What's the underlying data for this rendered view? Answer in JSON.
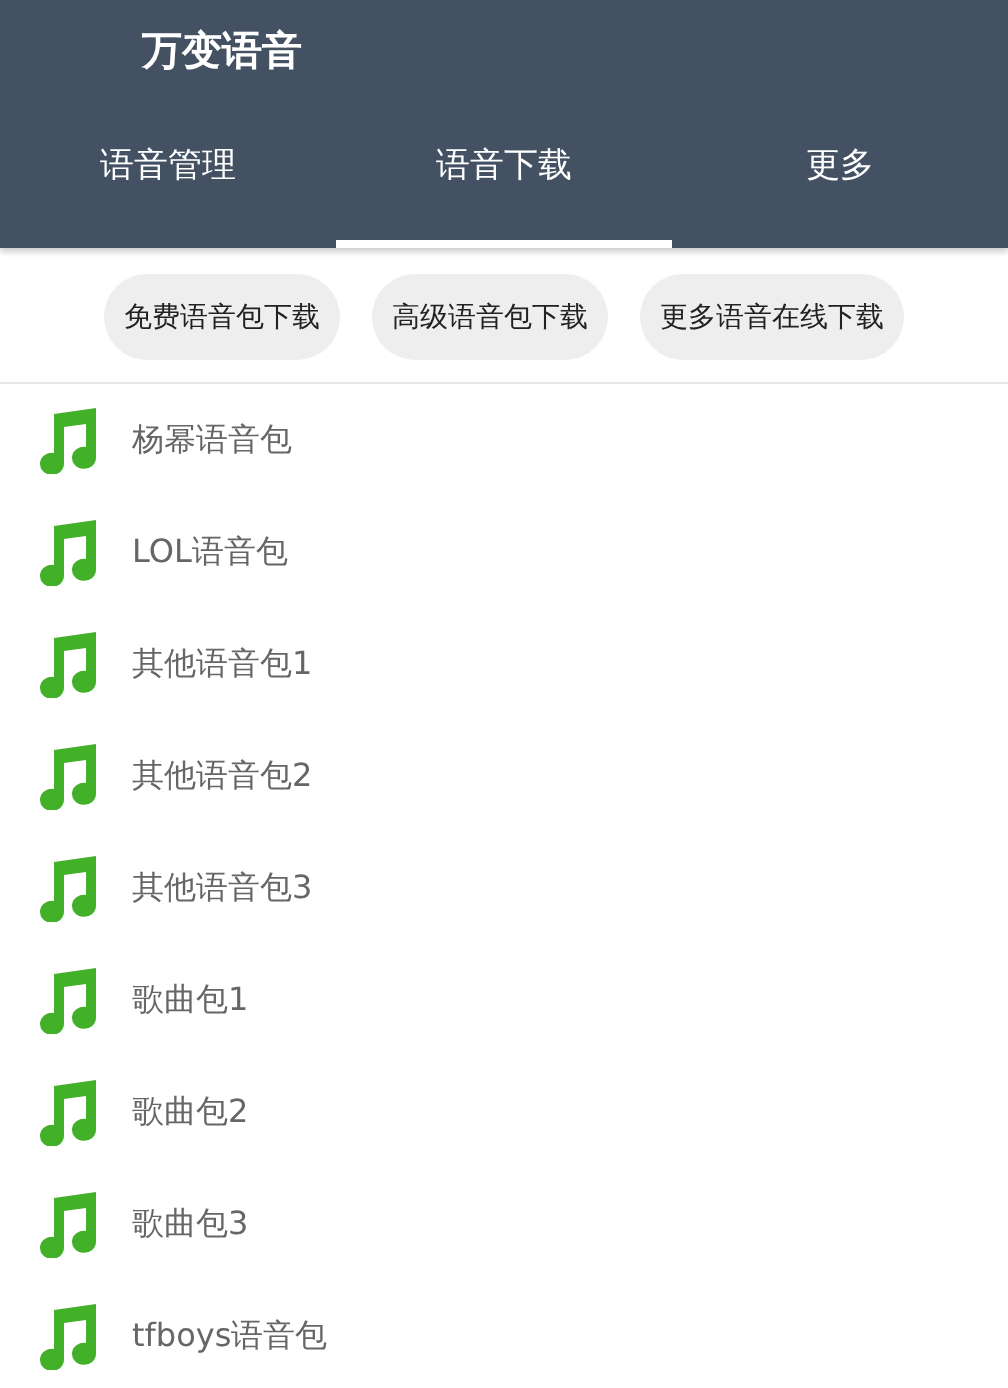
{
  "app_bar": {
    "title": "万变语音"
  },
  "tabs": [
    {
      "label": "语音管理",
      "selected": false
    },
    {
      "label": "语音下载",
      "selected": true
    },
    {
      "label": "更多",
      "selected": false
    }
  ],
  "chips": [
    "免费语音包下载",
    "高级语音包下载",
    "更多语音在线下载"
  ],
  "items": [
    {
      "label": "杨幂语音包"
    },
    {
      "label": "LOL语音包"
    },
    {
      "label": "其他语音包1"
    },
    {
      "label": "其他语音包2"
    },
    {
      "label": "其他语音包3"
    },
    {
      "label": "歌曲包1"
    },
    {
      "label": "歌曲包2"
    },
    {
      "label": "歌曲包3"
    },
    {
      "label": "tfboys语音包"
    }
  ]
}
